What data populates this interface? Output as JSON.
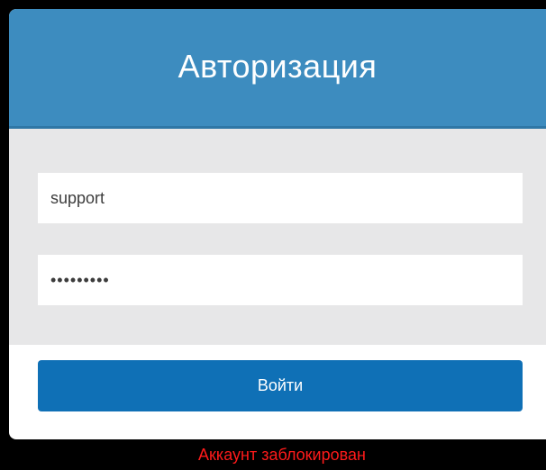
{
  "header": {
    "title": "Авторизация"
  },
  "form": {
    "login_value": "support",
    "password_value": "•••••••••",
    "submit_label": "Войти"
  },
  "status": {
    "error_text": "Аккаунт заблокирован"
  },
  "colors": {
    "header_bg": "#3d8cbf",
    "button_bg": "#0f70b6",
    "error_text": "#ff1a1a",
    "form_bg": "#e7e7e8"
  }
}
